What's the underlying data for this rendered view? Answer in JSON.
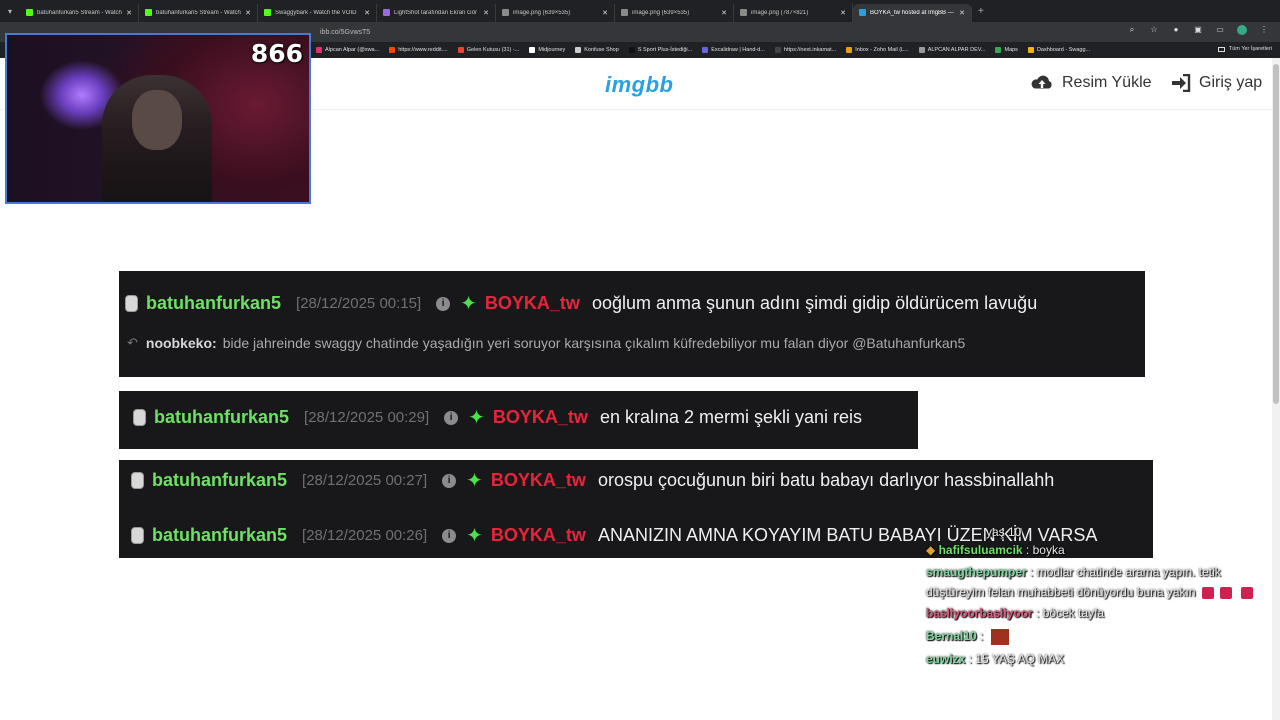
{
  "tabs": [
    {
      "title": "batuhanfurkan5 Stream - Watch",
      "color": "#53fc18",
      "active": false
    },
    {
      "title": "batuhanfurkan5 Stream - Watch",
      "color": "#53fc18",
      "active": false
    },
    {
      "title": "Swaggybark - Watch the VOID",
      "color": "#53fc18",
      "active": false
    },
    {
      "title": "LightShot tarafından Ekran Gör",
      "color": "#9c6ade",
      "active": false
    },
    {
      "title": "image.png (639×535)",
      "color": "#8a8a8a",
      "active": false
    },
    {
      "title": "image.png (639×535)",
      "color": "#8a8a8a",
      "active": false
    },
    {
      "title": "image.png (787×821)",
      "color": "#8a8a8a",
      "active": false
    },
    {
      "title": "BOYKA_tw hosted at ImgBB —",
      "color": "#2ba0e0",
      "active": true
    }
  ],
  "address": "ibb.co/5GvwsT5",
  "bookmarks": [
    {
      "label": "Alpcan Alpar (@swa...",
      "color": "#e1306c"
    },
    {
      "label": "https://www.reddit....",
      "color": "#ff4500"
    },
    {
      "label": "Gelen Kutusu (31) -...",
      "color": "#ea4335"
    },
    {
      "label": "Midjourney",
      "color": "#ffffff"
    },
    {
      "label": "Konfuse Shop",
      "color": "#cccccc"
    },
    {
      "label": "S Sport Plus-İstediği...",
      "color": "#111111"
    },
    {
      "label": "Excalidraw | Hand-d...",
      "color": "#6965db"
    },
    {
      "label": "https://next.inkamat...",
      "color": "#444444"
    },
    {
      "label": "Inbox - Zoho Mail (L...",
      "color": "#e5a00d"
    },
    {
      "label": "ALPCAN ALPAR DEV...",
      "color": "#999999"
    },
    {
      "label": "Maps",
      "color": "#34a853"
    },
    {
      "label": "Dashboard - Swagg...",
      "color": "#f4b400"
    }
  ],
  "bookmarks_right": "Tüm Yer İşaretleri",
  "site": {
    "logo": "imgbb",
    "upload_label": "Resim Yükle",
    "login_label": "Giriş yap"
  },
  "webcam": {
    "viewer_count": "866"
  },
  "panels": {
    "p1": {
      "user": "batuhanfurkan5",
      "time": "[28/12/2025 00:15]",
      "target": "BOYKA_tw",
      "text": "ooğlum anma şunun adını şimdi gidip öldürücem lavuğu",
      "reply_user": "noobkeko:",
      "reply_text": "bide jahreinde swaggy chatinde yaşadığın yeri soruyor karşısına çıkalım küfredebiliyor mu falan diyor @Batuhanfurkan5"
    },
    "p2": {
      "user": "batuhanfurkan5",
      "time": "[28/12/2025 00:29]",
      "target": "BOYKA_tw",
      "text": "en kralına 2 mermi şekli yani reis"
    },
    "p3a": {
      "user": "batuhanfurkan5",
      "time": "[28/12/2025 00:27]",
      "target": "BOYKA_tw",
      "text": "orospu çocuğunun biri batu babayı darlıyor hassbinallahh"
    },
    "p3b": {
      "user": "batuhanfurkan5",
      "time": "[28/12/2025 00:26]",
      "target": "BOYKA_tw",
      "text": "ANANIZIN AMNA KOYAYIM BATU BABAYI ÜZEN KİM VARSA"
    }
  },
  "chat": [
    {
      "user": "hafifsuluamcik",
      "color": "#6ee065",
      "text": "boyka"
    },
    {
      "user": "smaugthepumper",
      "color": "#7fd6a0",
      "text": "modlar chatinde arama yapın. tetik düştüreyim felan muhabbeti dönüyordu buna yakın"
    },
    {
      "user": "basliyoorbasliyoor",
      "color": "#e0557a",
      "text": "böcek tayfa"
    },
    {
      "user": "Bernal10",
      "color": "#7fd6a0",
      "text": ""
    },
    {
      "user": "euwizx",
      "color": "#7fd6a0",
      "text": "15 YAŞ AQ MAX"
    }
  ],
  "chat_top_fragment": "yaş 10"
}
